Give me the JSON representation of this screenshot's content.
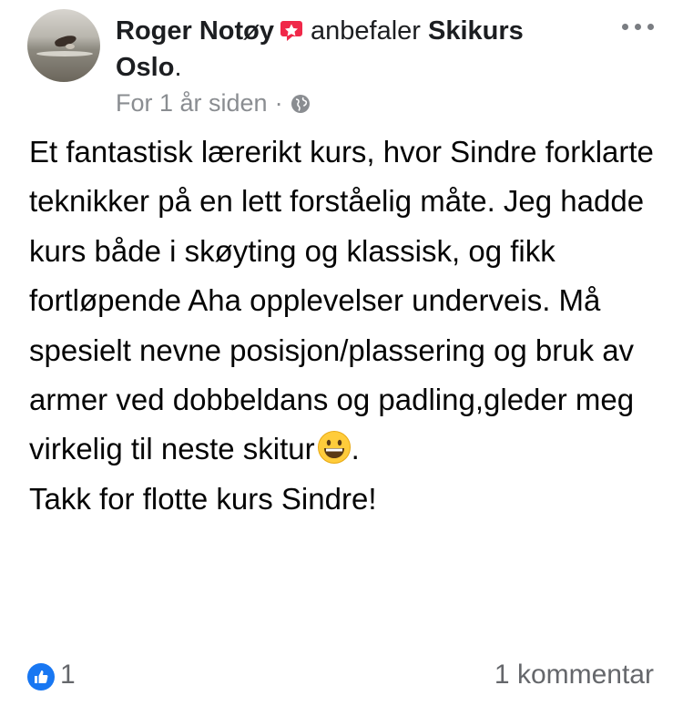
{
  "post": {
    "author": "Roger Notøy",
    "verb": "anbefaler",
    "page_name_part1": "Skikurs",
    "page_name_part2": "Oslo",
    "page_suffix": ".",
    "timestamp": "For 1 år siden",
    "separator": "·",
    "privacy_icon": "globe-icon",
    "recommend_icon": "recommend-badge-icon",
    "body_lines": [
      "Et fantastisk lærerikt kurs, hvor Sindre forklarte teknikker på en lett forståelig måte. Jeg hadde kurs både i skøyting og klassisk, og fikk fortløpende Aha opplevelser underveis. Må spesielt nevne posisjon/plassering og bruk av armer ved dobbeldans og padling,gleder meg virkelig til neste skitur"
    ],
    "body_after_emoji": ".",
    "closing_line": "Takk for flotte kurs Sindre!",
    "emoji": "grinning-face-emoji"
  },
  "footer": {
    "like_count": "1",
    "comments_label": "1 kommentar"
  },
  "colors": {
    "facebook_blue": "#1877f2",
    "recommend_red": "#f02849",
    "meta_gray": "#8a8d91",
    "footer_gray": "#65676b"
  }
}
